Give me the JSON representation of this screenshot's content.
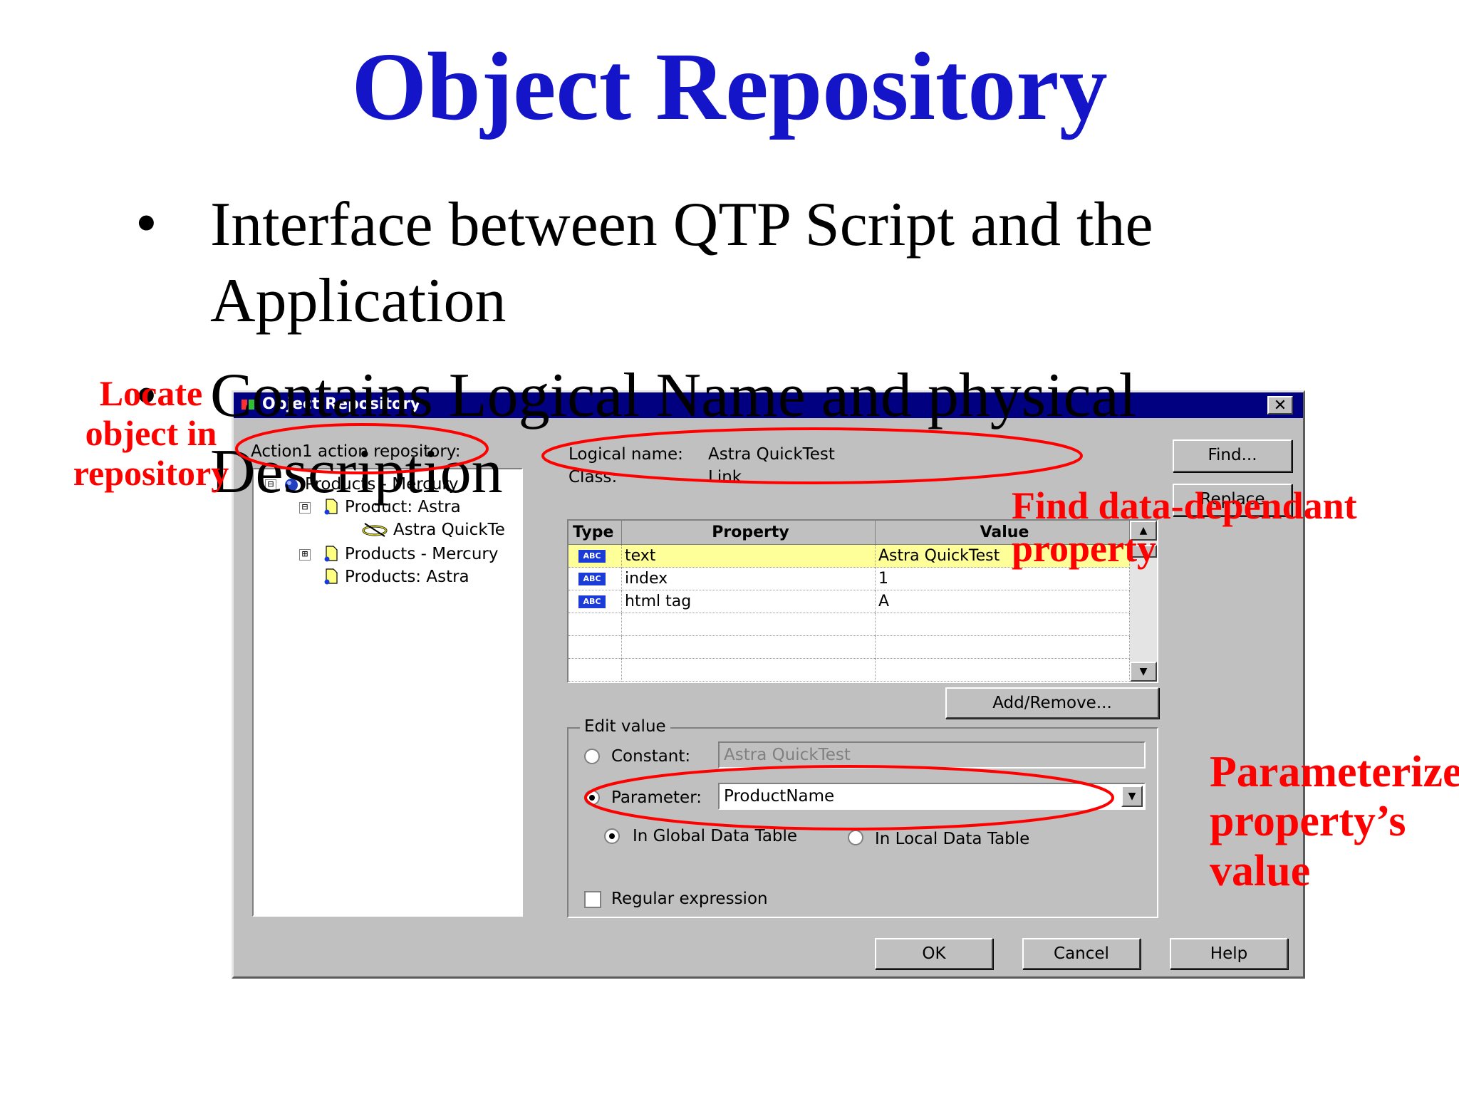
{
  "slide": {
    "title": "Object Repository",
    "bullets": [
      {
        "text": "Interface between QTP Script and the Application"
      },
      {
        "text": "Contains Logical Name and physical Description"
      }
    ]
  },
  "dialog": {
    "title": "Object Repository",
    "repository_label": "Action1 action repository:",
    "tree": [
      {
        "label": "Products - Mercury",
        "toggle": "⊟"
      },
      {
        "label": "Product: Astra",
        "toggle": "⊟"
      },
      {
        "label": "Astra QuickTe",
        "toggle": ""
      },
      {
        "label": "Products - Mercury",
        "toggle": "⊞"
      },
      {
        "label": "Products: Astra",
        "toggle": ""
      }
    ],
    "logical_name_label": "Logical name:",
    "logical_name_value": "Astra QuickTest",
    "class_label": "Class:",
    "class_value": "Link",
    "buttons": {
      "find": "Find...",
      "replace": "Replace",
      "add_remove": "Add/Remove...",
      "ok": "OK",
      "cancel": "Cancel",
      "help": "Help"
    },
    "grid": {
      "headers": [
        "Type",
        "Property",
        "Value"
      ],
      "type_badge": "ABC",
      "rows": [
        {
          "property": "text",
          "value": "Astra QuickTest",
          "selected": true
        },
        {
          "property": "index",
          "value": "1",
          "selected": false
        },
        {
          "property": "html tag",
          "value": "A",
          "selected": false
        }
      ]
    },
    "edit_value": {
      "label": "Edit value",
      "constant_label": "Constant:",
      "constant_value": "Astra QuickTest",
      "parameter_label": "Parameter:",
      "parameter_value": "ProductName",
      "global_table_label": "In Global Data Table",
      "local_table_label": "In Local Data Table",
      "regex_label": "Regular expression",
      "selected_mode": "parameter",
      "selected_table": "global",
      "regex_checked": false
    }
  },
  "annotations": {
    "locate": [
      "Locate",
      "object in",
      "repository"
    ],
    "find": [
      "Find data-dependant",
      "property"
    ],
    "parameterize": [
      "Parameterize",
      "property’s",
      "value"
    ]
  },
  "colors": {
    "title": "#1414c8",
    "annotation": "#ff0000",
    "titlebar": "#000080",
    "selected_row": "#ffff99"
  }
}
